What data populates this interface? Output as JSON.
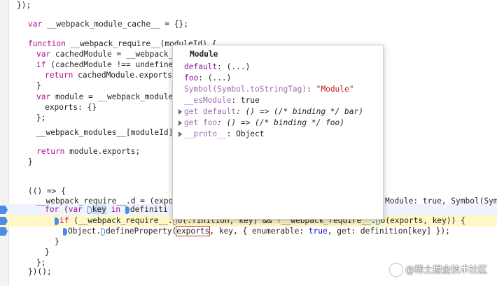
{
  "code": {
    "l1": "});",
    "l2_kw": "var",
    "l2_rest": " __webpack_module_cache__ = {};",
    "l3_kw": "function",
    "l3_rest": " __webpack_require__(moduleId) {",
    "l4_kw": "var",
    "l4_rest": " cachedModule = __webpack_m",
    "l5_kw": "if",
    "l5_rest": " (cachedModule !== undefined",
    "l6_kw": "return",
    "l6_rest": " cachedModule.exports",
    "l7": "}",
    "l8_kw": "var",
    "l8_rest": " module = __webpack_module_",
    "l9": "exports: {}",
    "l10": "};",
    "l11": "__webpack_modules__[moduleId]",
    "l12_kw": "return",
    "l12_rest": " module.exports;",
    "l13": "}",
    "l14": "(() => {",
    "l15_a": "__webpack_require__.d = (expor",
    "l15_b": "Module: true, Symbol(Symbo",
    "l16_kw1": "for",
    "l16_a": " (",
    "l16_kw2": "var",
    "l16_key": "key",
    "l16_kw3": "in",
    "l16_rest": "definiti",
    "l17_kw": "if",
    "l17_a": " (__webpack_require__.",
    "l17_b": "o(",
    "l17_c": ".finition, key) && !__webpack_require__.",
    "l17_d": "o(exports, key)) {",
    "l18_a": "Object.",
    "l18_b": "defineProperty(",
    "l18_exports": "exports",
    "l18_c": ", key, { enumerable: ",
    "l18_true": "true",
    "l18_d": ", get: definition[key] });",
    "l19": "}",
    "l20": "}",
    "l21": "};",
    "l22": "})();"
  },
  "popup": {
    "title": "Module",
    "rows": [
      {
        "key": "default",
        "val": ": (...)"
      },
      {
        "key": "foo",
        "val": ": (...)"
      },
      {
        "key": "Symbol(Symbol.toStringTag)",
        "val": ": ",
        "str": "\"Module\""
      },
      {
        "key": "__esModule",
        "val": ": true"
      },
      {
        "key": "get default",
        "val": ": () => (/* binding */ bar)"
      },
      {
        "key": "get foo",
        "val": ": () => (/* binding */ foo)"
      },
      {
        "key": "__proto__",
        "val": ": Object"
      }
    ]
  },
  "watermark": "@稀土掘金技术社区",
  "colors": {
    "keyword": "#aa0d91",
    "breakpoint": "#4c8be6",
    "highlight_line": "#fff7c6",
    "selection": "#c9d9f5"
  }
}
